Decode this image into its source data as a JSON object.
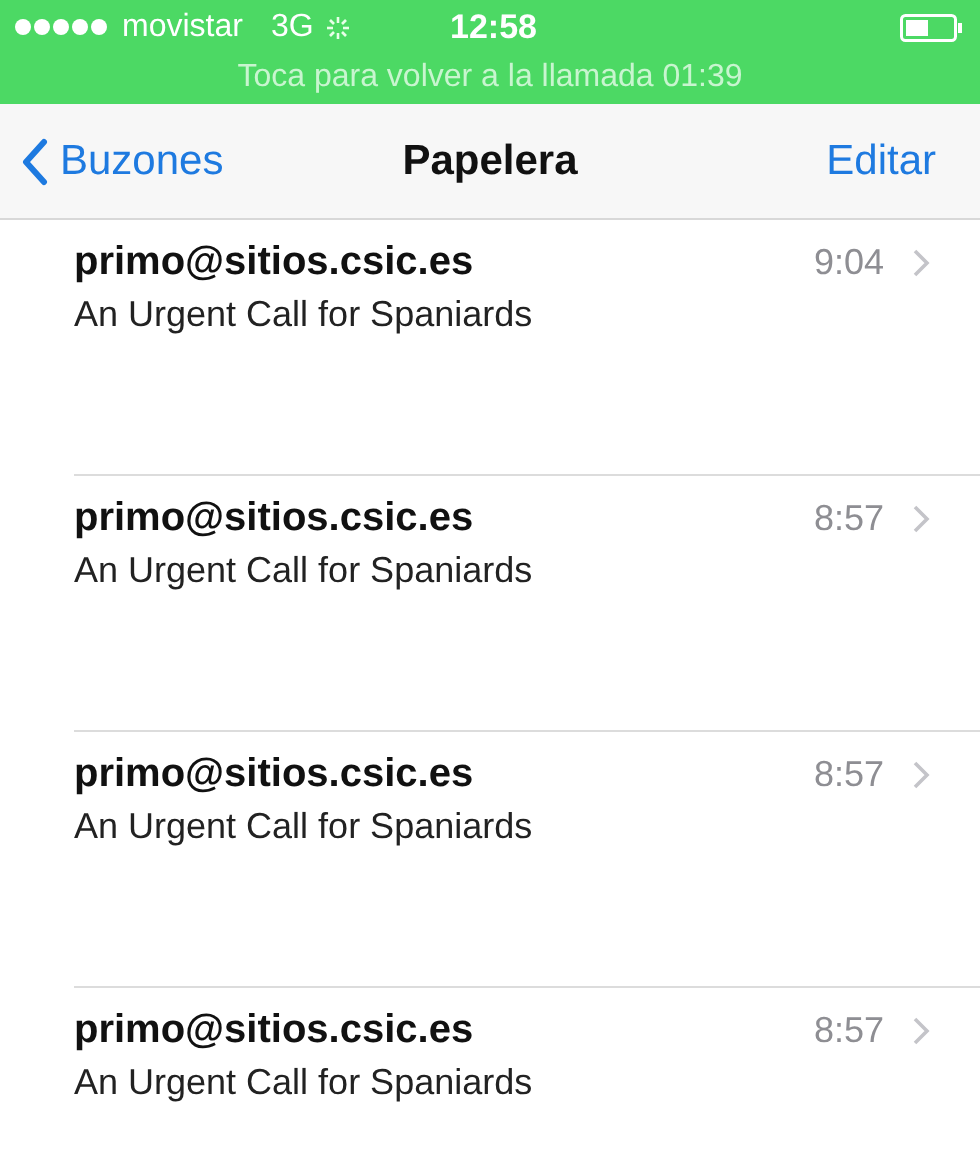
{
  "status_bar": {
    "carrier": "movistar",
    "network": "3G",
    "time": "12:58"
  },
  "call_banner": "Toca para volver a la llamada 01:39",
  "nav": {
    "back": "Buzones",
    "title": "Papelera",
    "action": "Editar"
  },
  "messages": [
    {
      "sender": "primo@sitios.csic.es",
      "subject": "An Urgent Call for Spaniards",
      "time": "9:04"
    },
    {
      "sender": "primo@sitios.csic.es",
      "subject": "An Urgent Call for Spaniards",
      "time": "8:57"
    },
    {
      "sender": "primo@sitios.csic.es",
      "subject": "An Urgent Call for Spaniards",
      "time": "8:57"
    },
    {
      "sender": "primo@sitios.csic.es",
      "subject": "An Urgent Call for Spaniards",
      "time": "8:57"
    }
  ]
}
